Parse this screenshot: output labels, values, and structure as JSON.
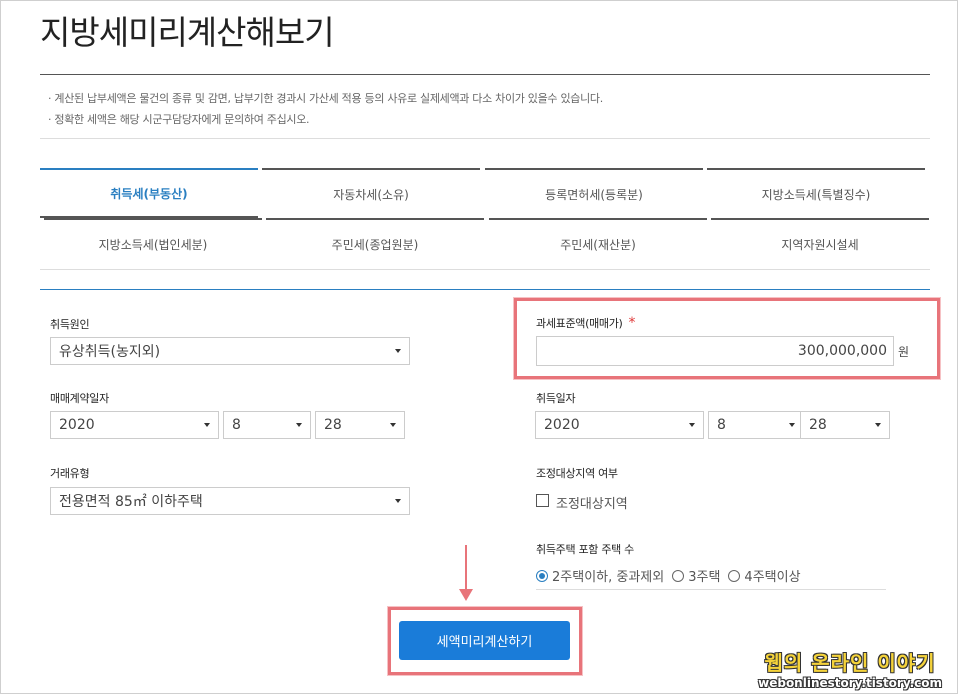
{
  "page": {
    "title": "지방세미리계산해보기",
    "notices": [
      "· 계산된 납부세액은 물건의 종류 및 감면, 납부기한 경과시 가산세 적용 등의 사유로 실제세액과 다소 차이가 있을수 있습니다.",
      "· 정확한 세액은 해당 시군구담당자에게 문의하여 주십시오."
    ]
  },
  "tabs": {
    "row1": [
      "취득세(부동산)",
      "자동차세(소유)",
      "등록면허세(등록분)",
      "지방소득세(특별징수)"
    ],
    "row2": [
      "지방소득세(법인세분)",
      "주민세(종업원분)",
      "주민세(재산분)",
      "지역자원시설세"
    ],
    "active": "취득세(부동산)"
  },
  "form": {
    "acq_cause": {
      "label": "취득원인",
      "value": "유상취득(농지외)"
    },
    "tax_base": {
      "label": "과세표준액(매매가)",
      "required_mark": "*",
      "value": "300,000,000",
      "unit": "원"
    },
    "contract_date": {
      "label": "매매계약일자",
      "year": "2020",
      "month": "8",
      "day": "28"
    },
    "acq_date": {
      "label": "취득일자",
      "year": "2020",
      "month": "8",
      "day": "28"
    },
    "trade_type": {
      "label": "거래유형",
      "value": "전용면적 85㎡ 이하주택"
    },
    "adjust_region": {
      "label": "조정대상지역 여부",
      "checkbox_label": "조정대상지역",
      "checked": false
    },
    "house_count": {
      "label": "취득주택 포함 주택 수",
      "options": [
        "2주택이하, 중과제외",
        "3주택",
        "4주택이상"
      ],
      "selected": "2주택이하, 중과제외"
    },
    "submit_label": "세액미리계산하기"
  },
  "watermark": {
    "main": "웹의 온라인 이야기",
    "sub": "webonlinestory.tistory.com"
  },
  "colors": {
    "accent": "#2a7fc1",
    "button": "#1a7cd9",
    "highlight": "#e8747a",
    "required": "#e03a3a"
  }
}
